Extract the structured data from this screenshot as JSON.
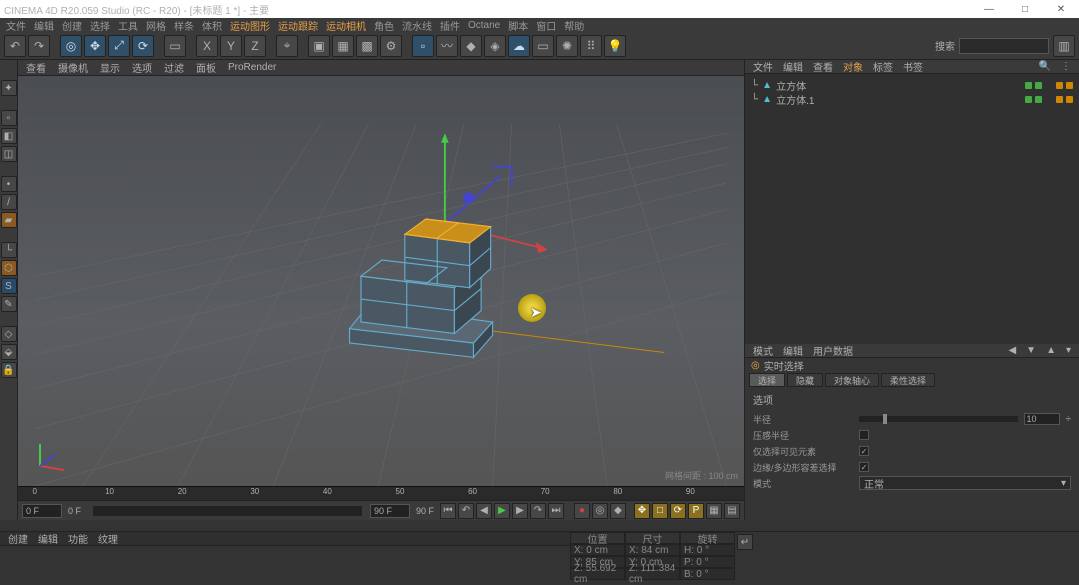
{
  "title": "CINEMA 4D R20.059 Studio (RC - R20) - [未标题 1 *] - 主要",
  "winbtns": {
    "min": "—",
    "max": "□",
    "close": "✕"
  },
  "menu": [
    "文件",
    "编辑",
    "创建",
    "选择",
    "工具",
    "网格",
    "样条",
    "体积",
    "运动图形",
    "运动跟踪",
    "运动相机",
    "角色",
    "流水线",
    "插件",
    "Octane",
    "脚本",
    "窗口",
    "帮助"
  ],
  "menu_hl_idx": 8,
  "search_label": "搜索",
  "vptabs": [
    "查看",
    "摄像机",
    "显示",
    "选项",
    "过滤",
    "面板",
    "ProRender"
  ],
  "vpinfo": "网格间距 : 100 cm",
  "timeline": {
    "start": 0,
    "end": 90,
    "marks": [
      0,
      10,
      20,
      30,
      40,
      50,
      60,
      70,
      80,
      90
    ]
  },
  "timectrl": {
    "startF": "0 F",
    "curF": "0 F",
    "endF": "90 F",
    "end2": "90 F",
    "fwd": "N"
  },
  "om_tabs": [
    "文件",
    "编辑",
    "查看",
    "对象",
    "标签",
    "书签"
  ],
  "om_active": 3,
  "omitems": [
    {
      "name": "立方体",
      "dots": [
        "g",
        "g",
        "o"
      ]
    },
    {
      "name": "立方体.1",
      "dots": [
        "g",
        "g",
        "o"
      ]
    }
  ],
  "am_tabs": [
    "模式",
    "编辑",
    "用户数据"
  ],
  "am_title": "实时选择",
  "am_subtabs": [
    "选择",
    "隐藏",
    "对象轴心",
    "柔性选择"
  ],
  "am_subtab_active": 0,
  "am_section": "选项",
  "attrs": {
    "radius_lbl": "半径",
    "radius_val": "10",
    "radius_spin": "÷",
    "pressure_lbl": "压感半径",
    "pressure_chk": false,
    "visible_lbl": "仅选择可见元素",
    "visible_chk": true,
    "edge_lbl": "边缘/多边形容差选择",
    "edge_chk": true,
    "mode_lbl": "模式",
    "mode_val": "正常"
  },
  "status_tabs": [
    "创建",
    "编辑",
    "功能",
    "纹理"
  ],
  "coord": {
    "hdr": [
      "位置",
      "尺寸",
      "旋转"
    ],
    "X": {
      "p": "X: 0 cm",
      "s": "X: 84 cm",
      "r": "H: 0 °"
    },
    "Y": {
      "p": "Y: 85 cm",
      "s": "Y: 0 cm",
      "r": "P: 0 °"
    },
    "Z": {
      "p": "Z: 55.692 cm",
      "s": "Z: 111.384 cm",
      "r": "B: 0 °"
    }
  },
  "tool_axes": [
    "X",
    "Y",
    "Z"
  ]
}
